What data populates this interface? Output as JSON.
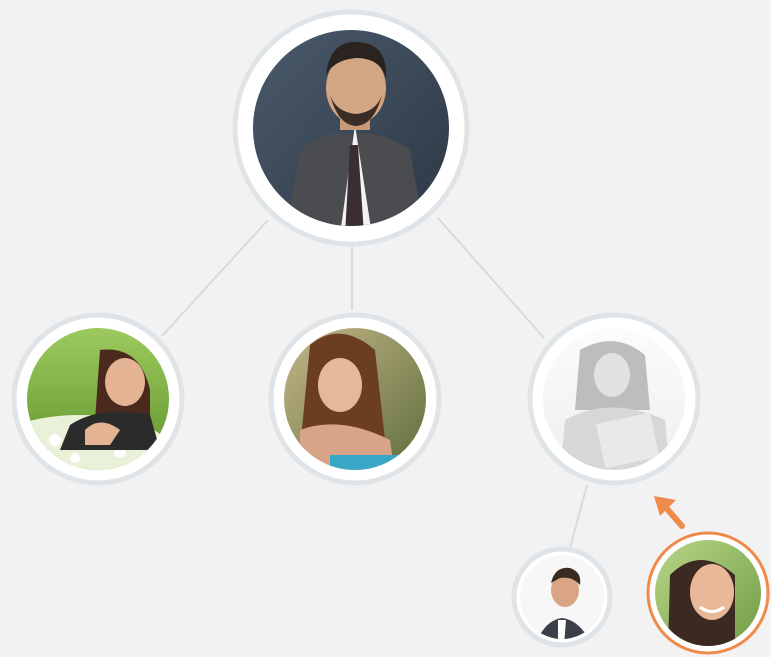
{
  "diagram": {
    "title": "",
    "nodes": [
      {
        "id": "manager",
        "kind": "photo",
        "depicts": "man-in-suit-and-tie",
        "state": "normal"
      },
      {
        "id": "employee-1",
        "kind": "photo",
        "depicts": "woman-lying-in-flowers",
        "state": "normal"
      },
      {
        "id": "employee-2",
        "kind": "photo",
        "depicts": "woman-with-long-hair",
        "state": "normal"
      },
      {
        "id": "employee-3",
        "kind": "photo",
        "depicts": "woman-holding-folder",
        "state": "faded"
      },
      {
        "id": "sub-employee",
        "kind": "photo",
        "depicts": "smiling-man-in-suit",
        "state": "normal"
      },
      {
        "id": "new-member",
        "kind": "photo",
        "depicts": "smiling-woman",
        "state": "highlighted"
      }
    ],
    "edges": [
      {
        "from": "manager",
        "to": "employee-1"
      },
      {
        "from": "manager",
        "to": "employee-2"
      },
      {
        "from": "manager",
        "to": "employee-3"
      },
      {
        "from": "employee-3",
        "to": "sub-employee"
      }
    ],
    "pointer": {
      "from": "new-member",
      "to": "employee-3",
      "icon": "arrow-up-left-icon"
    },
    "colors": {
      "background": "#f2f2f2",
      "ring": "#dfe4e8",
      "connector": "#d7dcd9",
      "accent": "#f08a4b"
    }
  }
}
